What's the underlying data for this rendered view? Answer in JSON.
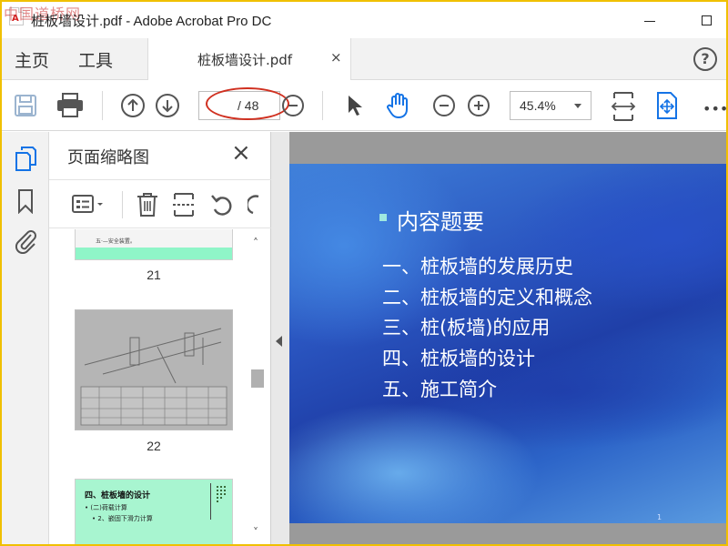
{
  "window": {
    "watermark": "中国道桥网",
    "title": "桩板墙设计.pdf - Adobe Acrobat Pro DC"
  },
  "tabs": {
    "home": "主页",
    "tools": "工具",
    "document": "桩板墙设计.pdf",
    "close": "×",
    "help": "?"
  },
  "toolbar": {
    "current_page": "",
    "total_pages": "/ 48",
    "zoom": "45.4%"
  },
  "thumbnails": {
    "title": "页面缩略图",
    "close": "×",
    "pages": [
      {
        "number": "21",
        "text": "五·—安全装置。"
      },
      {
        "number": "22",
        "text": ""
      },
      {
        "number": "",
        "title": "四、桩板墙的设计",
        "lines": [
          "(二)荷载计算",
          "2、嵌固下滑力计算"
        ]
      }
    ]
  },
  "slide": {
    "title": "内容题要",
    "items": [
      "一、桩板墙的发展历史",
      "二、桩板墙的定义和概念",
      "三、桩(板墙)的应用",
      "四、桩板墙的设计",
      "五、施工简介"
    ],
    "page_mark": "1"
  },
  "colors": {
    "frame_border": "#f0c000",
    "annotation_oval": "#d03020",
    "accent_blue": "#1473e6",
    "slide_bg": "#2a55c0"
  }
}
